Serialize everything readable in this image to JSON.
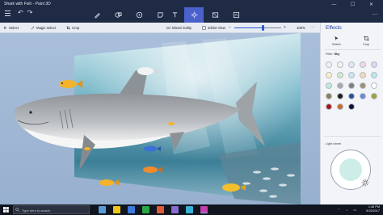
{
  "window": {
    "title": "Shark with Fish - Paint 3D",
    "controls": "—  ☐  ✕",
    "more": "···"
  },
  "toolbar": {
    "undo_redo": "↶↷",
    "tools": [
      {
        "name": "brushes",
        "icon": "brush-icon"
      },
      {
        "name": "2d-shapes",
        "icon": "shapes-2d-icon"
      },
      {
        "name": "3d-shapes",
        "icon": "cube-icon"
      },
      {
        "name": "stickers",
        "icon": "sticker-icon"
      },
      {
        "name": "text",
        "icon": "text-icon"
      },
      {
        "name": "effects",
        "icon": "effects-icon",
        "active": true
      },
      {
        "name": "canvas",
        "icon": "canvas-icon"
      },
      {
        "name": "remix",
        "icon": "remix-icon"
      }
    ]
  },
  "subbar": {
    "select": "Select",
    "magic_select": "Magic select",
    "crop": "Crop",
    "mixed_reality": "Mixed reality",
    "switch_view": "3d/2D View",
    "zoom_value": 0.62,
    "zoom_label": "100%"
  },
  "panel": {
    "title": "Effects",
    "select_label": "Select",
    "crop_label": "Crop",
    "filter_prefix": "Filter: ",
    "filter_value": "Sky",
    "swatches": [
      "#f1f1f1",
      "#f3f3f3",
      "#dfe8f7",
      "#f4d7e2",
      "#ddd6f0",
      "#fbf1c6",
      "#d4e9c6",
      "#cbe7ea",
      "#f3d9b8",
      "#bce8e9",
      "#bfe9d8",
      "#a9a9a9",
      "#7f7f7f",
      "#a18f71",
      "#ffffff",
      "#8a7d5a",
      "#1e1e1e",
      "#2a4f99",
      "#6e87d6",
      "#9f9f3a",
      "#a3161b",
      "#c56b2a",
      "#0d1433"
    ],
    "light_label": "Light wheel"
  },
  "taskbar": {
    "search_placeholder": "Type here to search",
    "time": "1:46 PM",
    "date": "9/15/2017",
    "apps": [
      "#5b9bd5",
      "#f0c419",
      "#3a7be0",
      "#28a745",
      "#e05a3a",
      "#8a6bd1",
      "#37b1d6",
      "#c23ea8"
    ]
  }
}
